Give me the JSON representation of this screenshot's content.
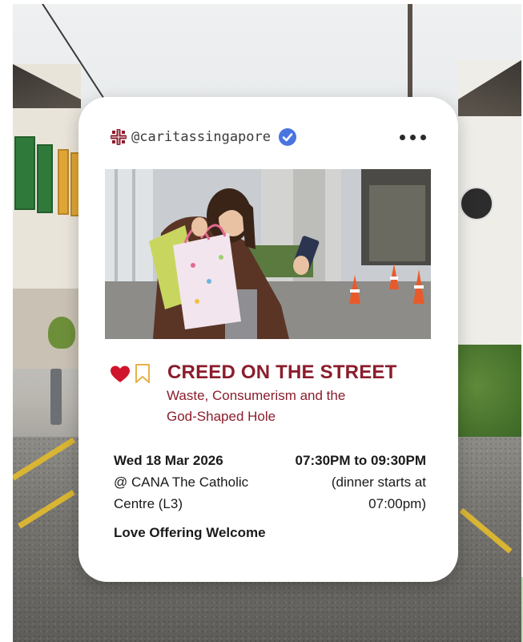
{
  "post": {
    "handle": "@caritassingapore",
    "verified": true,
    "icons": {
      "org_logo": "caritas-logo-icon",
      "verified": "verified-check-icon",
      "more": "more-options-icon",
      "like": "heart-icon",
      "save": "bookmark-icon"
    },
    "colors": {
      "accent": "#8b1d2c",
      "verified": "#4a74e0",
      "like": "#d0142c",
      "bookmark": "#e6b24a"
    }
  },
  "event": {
    "title": "CREED ON THE STREET",
    "subtitle_line1": "Waste, Consumerism and the",
    "subtitle_line2": "God-Shaped Hole",
    "date": "Wed 18 Mar 2026",
    "venue_line1": "@ CANA The Catholic",
    "venue_line2": "Centre (L3)",
    "time": "07:30PM to 09:30PM",
    "dinner_line1": "(dinner starts at",
    "dinner_line2": "07:00pm)",
    "offering": "Love Offering Welcome"
  }
}
